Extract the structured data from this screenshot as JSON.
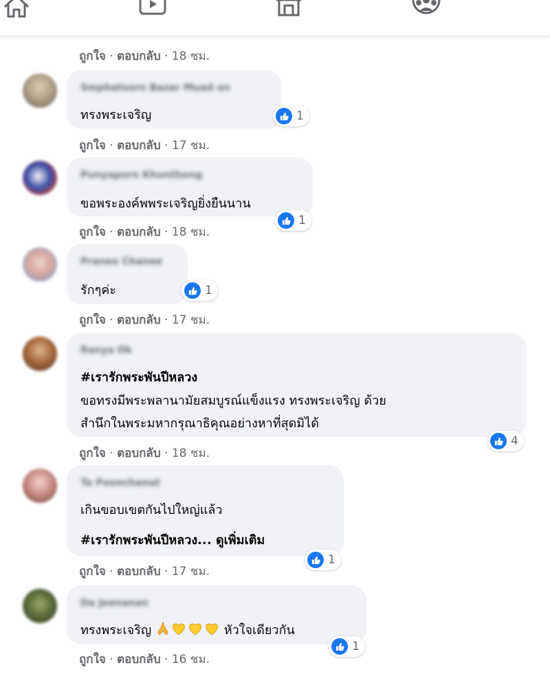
{
  "nav": {
    "icons": [
      "home-icon",
      "watch-icon",
      "marketplace-icon",
      "groups-icon"
    ]
  },
  "colors": {
    "like_blue": "#1877f2",
    "bubble_gray": "#f0f2f5",
    "meta_gray": "#65676b"
  },
  "labels": {
    "like": "ถูกใจ",
    "reply": "ตอบกลับ",
    "separator": " · "
  },
  "top_actions": {
    "time": "18 ชม."
  },
  "comments": [
    {
      "name": "Smphatsorn Bazar Muad on",
      "lines": [
        "ทรงพระเจริญ"
      ],
      "reactions": "1",
      "time": "17 ชม."
    },
    {
      "name": "Punyaporn Khunthong",
      "lines": [
        "ขอพระองค์พพระเจริญยิ่งยืนนาน"
      ],
      "reactions": "1",
      "time": "18 ชม."
    },
    {
      "name": "Pranee Chanee",
      "lines": [
        "รักๆค่ะ"
      ],
      "reactions": "1",
      "time": "17 ชม."
    },
    {
      "name": "Ranya Ok",
      "hashtag": "#เรารักพระพันปีหลวง",
      "lines": [
        "ขอทรงมีพระพลานามัยสมบูรณ์แข็งแรง ทรงพระเจริญ ด้วย",
        "สำนึกในพระมหากรุณาธิคุณอย่างหาที่สุดมิได้"
      ],
      "reactions": "4",
      "time": "18 ชม."
    },
    {
      "name": "Ta Poonchanut",
      "lines": [
        "เกินขอบเขตกันไปใหญ่แล้ว"
      ],
      "hashtag_more": "#เรารักพระพันปีหลวง...",
      "see_more": "ดูเพิ่มเติม",
      "reactions": "1",
      "time": "17 ชม."
    },
    {
      "name": "Da Jeenanan",
      "lines_prefix": "ทรงพระเจริญ",
      "emojis": [
        "folded-hands-icon",
        "yellow-heart-icon",
        "yellow-heart-icon",
        "yellow-heart-icon"
      ],
      "lines_suffix": "หัวใจเดียวกัน",
      "reactions": "1",
      "time": "16 ชม."
    }
  ]
}
